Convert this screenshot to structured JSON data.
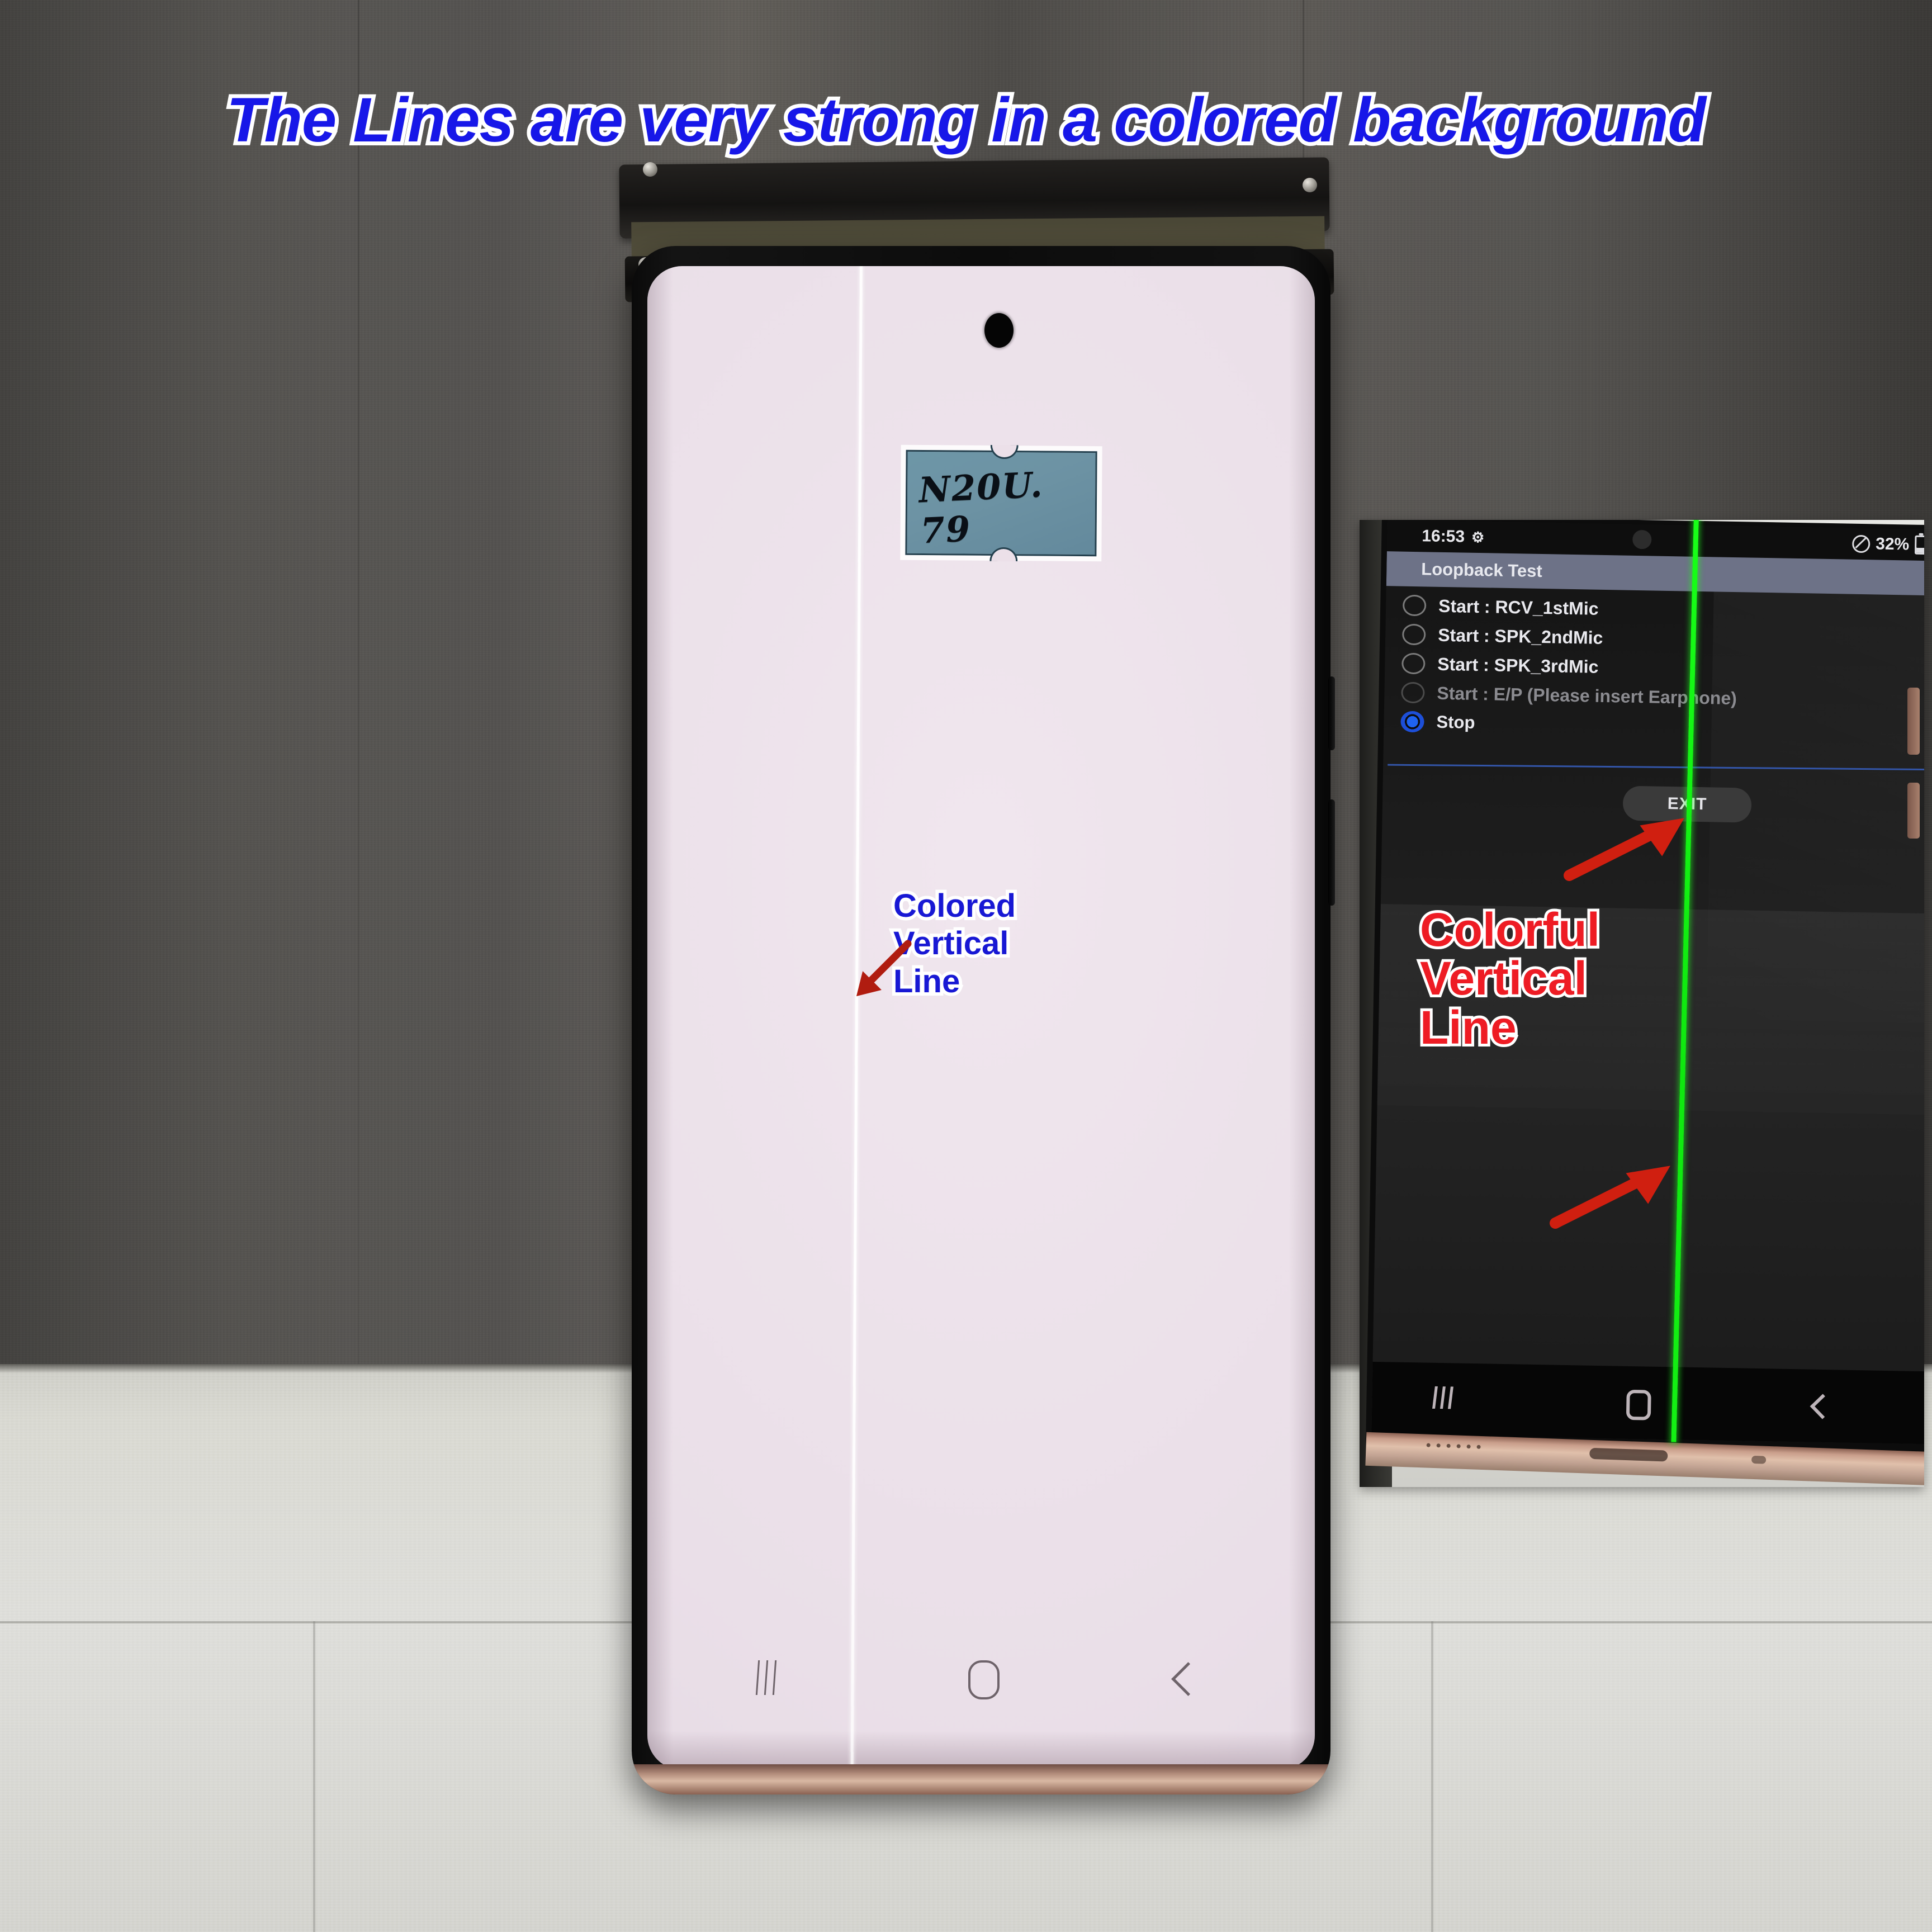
{
  "title": {
    "text": "The Lines are very strong in a colored background",
    "color": "#1717e8",
    "outline": "#ffffff"
  },
  "main_phone": {
    "screen_color": "#ece0e9",
    "defect_label_lines": [
      "Colored",
      "Vertical",
      "Line"
    ],
    "defect_label_color": "#1818d4",
    "arrow_color": "#b01c10",
    "sticky_note": {
      "text": "N20U. 79",
      "color": "#6d93a4"
    },
    "navbar": {
      "recent_icon": "recent-apps-icon",
      "home_icon": "home-icon",
      "back_icon": "back-icon"
    }
  },
  "inset_phone": {
    "status_bar": {
      "time": "16:53",
      "gear_icon": "gear-icon",
      "mute_icon": "mute-icon",
      "battery_percent": "32%",
      "battery_icon": "battery-icon"
    },
    "app_bar": {
      "title": "Loopback Test"
    },
    "options": [
      {
        "label": "Start : RCV_1stMic",
        "selected": false,
        "disabled": false
      },
      {
        "label": "Start : SPK_2ndMic",
        "selected": false,
        "disabled": false
      },
      {
        "label": "Start : SPK_3rdMic",
        "selected": false,
        "disabled": false
      },
      {
        "label": "Start : E/P (Please insert Earphone)",
        "selected": false,
        "disabled": true
      },
      {
        "label": "Stop",
        "selected": true,
        "disabled": false
      }
    ],
    "exit_button": "EXIT",
    "defect_label_lines": [
      "Colorful",
      "Vertical",
      "Line"
    ],
    "defect_label_color": "#ee1c24",
    "defect_line_color": "#14f014",
    "arrow_color": "#d01f10",
    "navbar": {
      "recent_icon": "recent-apps-icon",
      "home_icon": "home-icon",
      "back_icon": "back-icon"
    }
  }
}
